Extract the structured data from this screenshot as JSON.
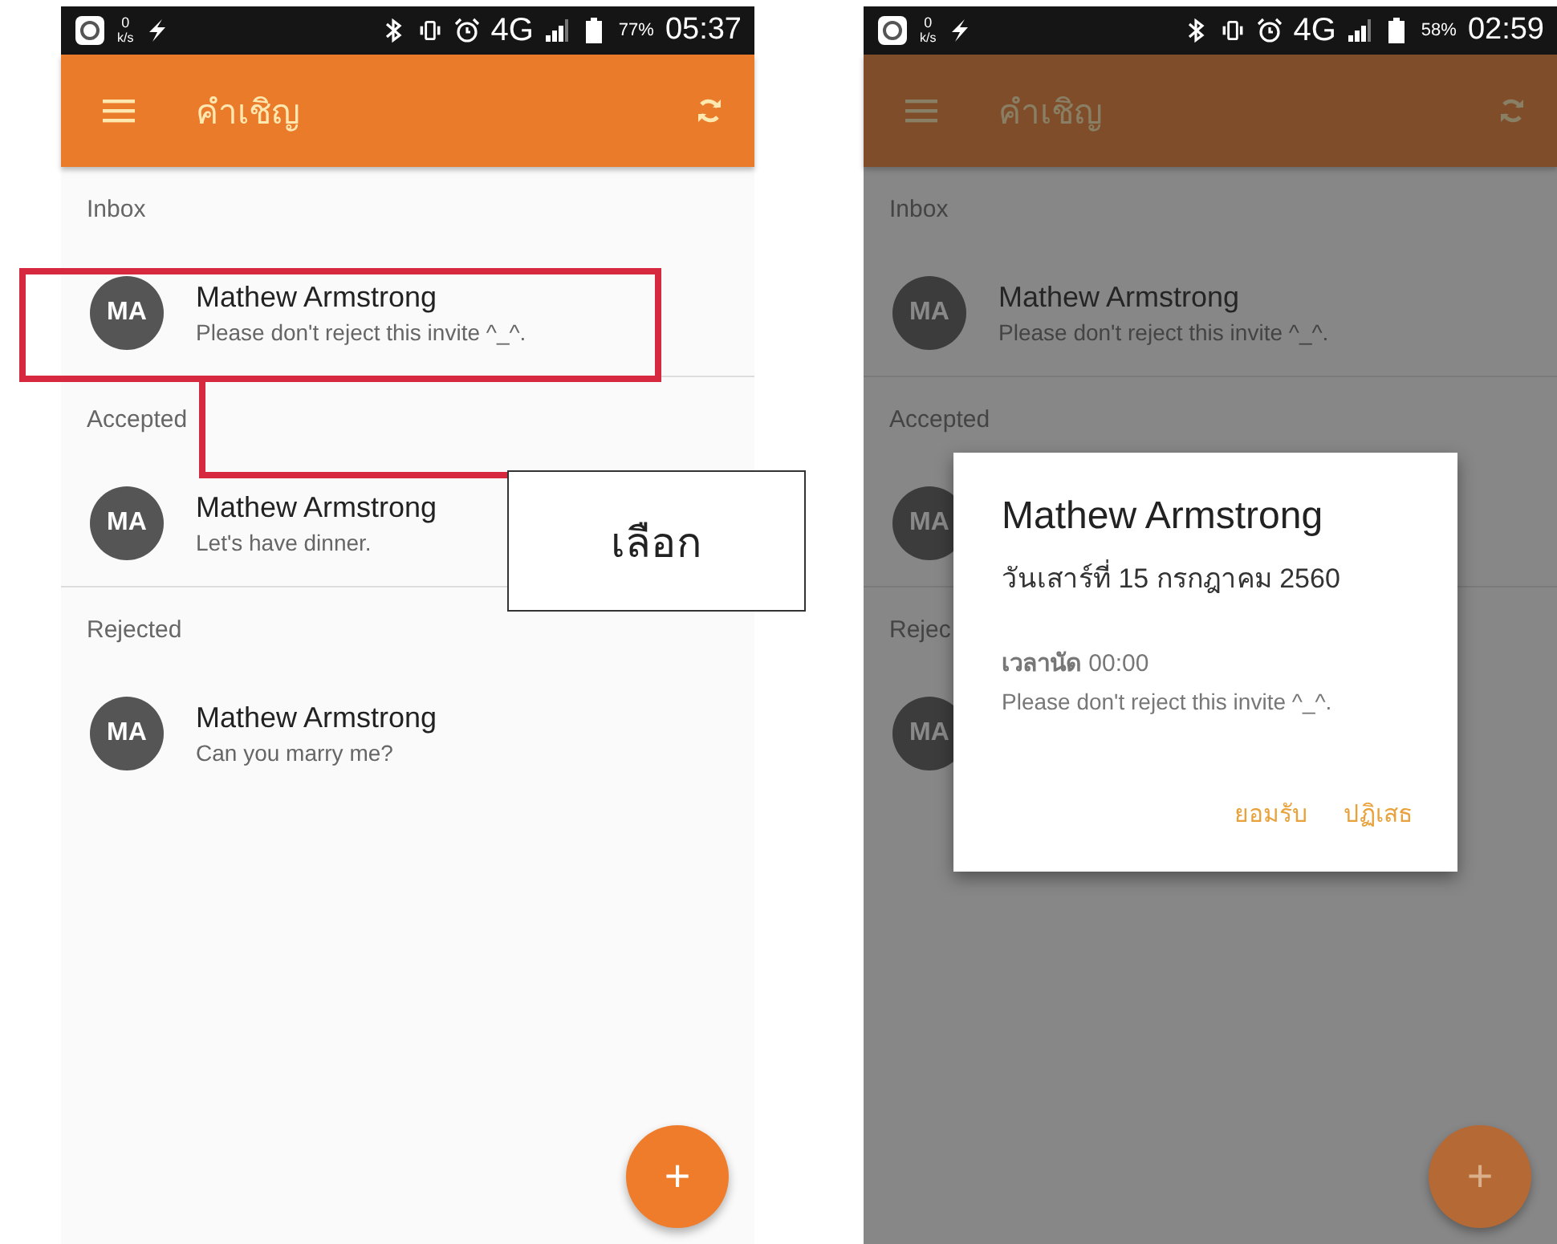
{
  "screens": [
    {
      "status_bar": {
        "speed": "0",
        "speed_unit": "k/s",
        "network": "4G",
        "battery": "77%",
        "time": "05:37"
      },
      "app_bar": {
        "title": "คำเชิญ"
      },
      "dimmed": false,
      "sections": [
        {
          "label": "Inbox",
          "items": [
            {
              "initials": "MA",
              "name": "Mathew Armstrong",
              "message": "Please don't reject this invite ^_^."
            }
          ]
        },
        {
          "label": "Accepted",
          "items": [
            {
              "initials": "MA",
              "name": "Mathew Armstrong",
              "message": "Let's have dinner."
            }
          ]
        },
        {
          "label": "Rejected",
          "items": [
            {
              "initials": "MA",
              "name": "Mathew Armstrong",
              "message": "Can you marry me?"
            }
          ]
        }
      ],
      "fab": "+"
    },
    {
      "status_bar": {
        "speed": "0",
        "speed_unit": "k/s",
        "network": "4G",
        "battery": "58%",
        "time": "02:59"
      },
      "app_bar": {
        "title": "คำเชิญ"
      },
      "dimmed": true,
      "sections": [
        {
          "label": "Inbox",
          "items": [
            {
              "initials": "MA",
              "name": "Mathew Armstrong",
              "message": "Please don't reject this invite ^_^."
            }
          ]
        },
        {
          "label": "Accepted",
          "items": [
            {
              "initials": "MA"
            }
          ]
        },
        {
          "label": "Rejec",
          "items": [
            {
              "initials": "MA"
            }
          ]
        }
      ],
      "fab": "+",
      "dialog": {
        "title": "Mathew Armstrong",
        "date": "วันเสาร์ที่ 15 กรกฎาคม 2560",
        "time_label": "เวลานัด",
        "time": "00:00",
        "message": "Please don't reject this invite ^_^.",
        "buttons": [
          "ยอมรับ",
          "ปฏิเสธ"
        ]
      }
    }
  ],
  "annotation": {
    "label": "เลือก"
  }
}
